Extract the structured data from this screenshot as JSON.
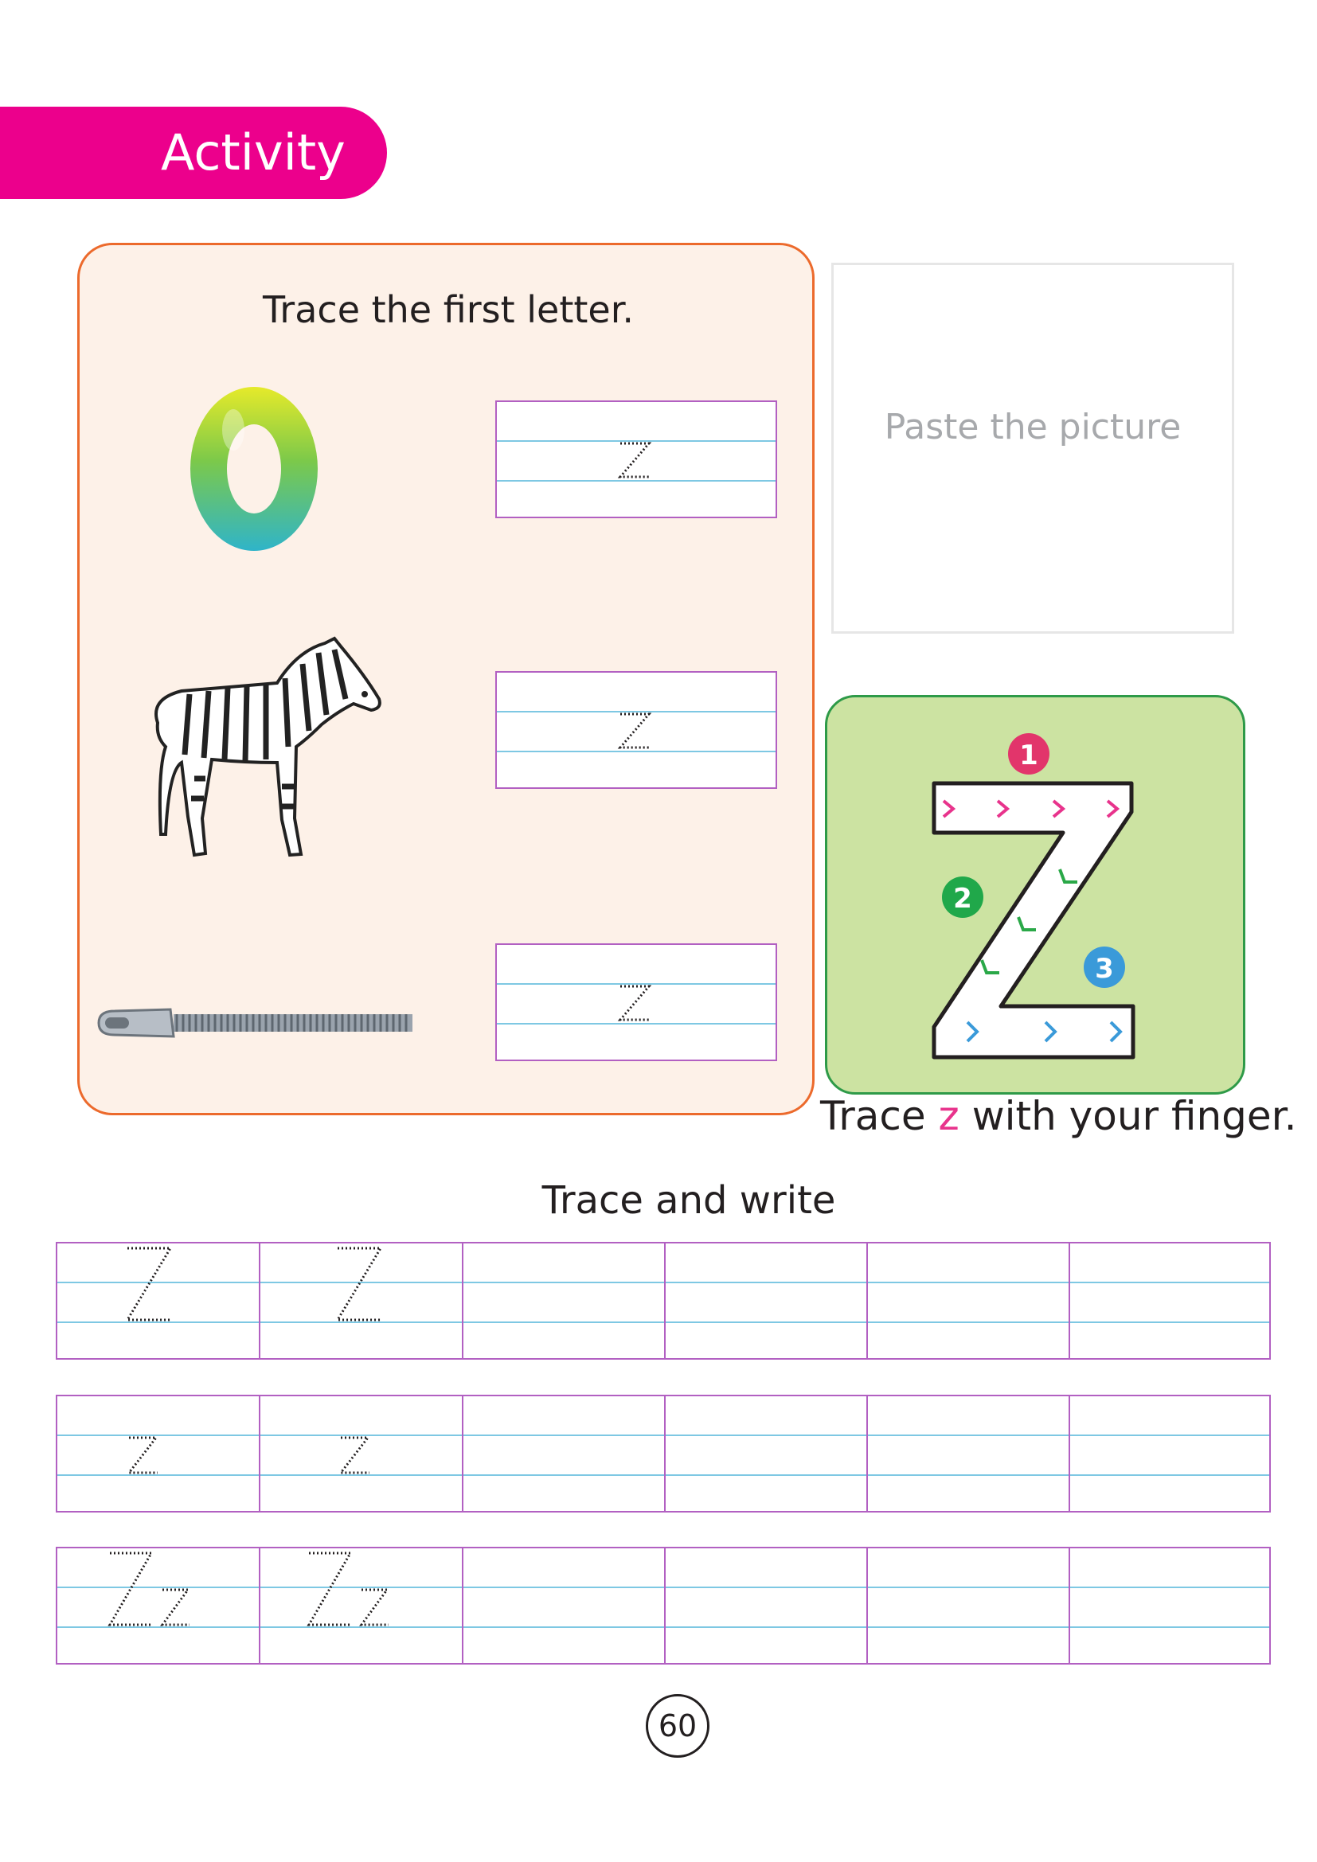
{
  "header": {
    "title": "Activity"
  },
  "trace_panel": {
    "instruction": "Trace the first letter.",
    "items": [
      {
        "picture": "number-zero-icon",
        "letter": "z"
      },
      {
        "picture": "zebra-icon",
        "letter": "z"
      },
      {
        "picture": "zipper-icon",
        "letter": "z"
      }
    ]
  },
  "paste_box": {
    "text": "Paste the picture"
  },
  "finger_trace": {
    "steps": [
      "1",
      "2",
      "3"
    ],
    "caption_before": "Trace ",
    "caption_letter": "z",
    "caption_after": " with your finger."
  },
  "trace_write": {
    "title": "Trace and write",
    "rows": [
      {
        "letters": [
          "Z",
          "Z"
        ]
      },
      {
        "letters": [
          "z",
          "z"
        ]
      },
      {
        "letters": [
          "Zz",
          "Zz"
        ]
      }
    ]
  },
  "page_number": "60",
  "colors": {
    "accent": "#ec008c",
    "panel_border": "#ec6a2c",
    "green_panel": "#cce3a2"
  }
}
